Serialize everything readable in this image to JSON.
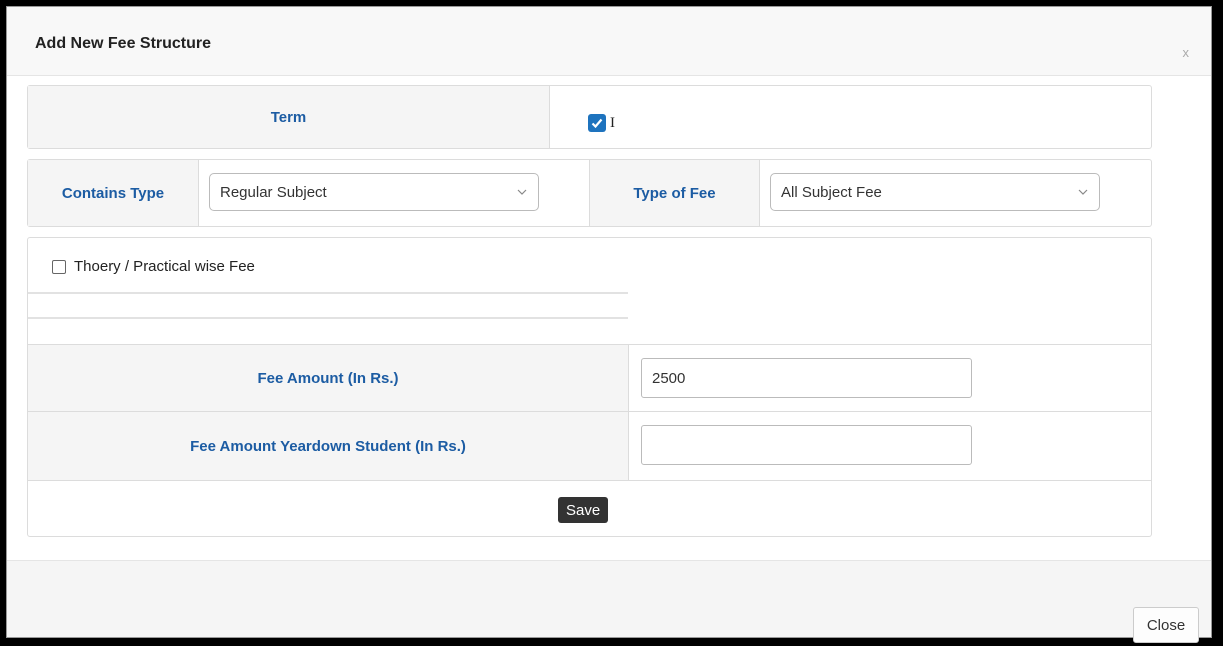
{
  "modal": {
    "title": "Add New Fee Structure",
    "close_glyph": "x"
  },
  "term": {
    "label": "Term",
    "checkbox_checked": true,
    "checkbox_label": "I",
    "check_icon": "check-icon"
  },
  "type_row": {
    "contains_type_label": "Contains Type",
    "contains_type_value": "Regular Subject",
    "type_of_fee_label": "Type of Fee",
    "type_of_fee_value": "All Subject Fee",
    "chevron_icon": "chevron-down-icon"
  },
  "thoery": {
    "checkbox_checked": false,
    "label": "Thoery / Practical wise Fee"
  },
  "fee_amount": {
    "label": "Fee Amount (In Rs.)",
    "value": "2500"
  },
  "fee_yeardown": {
    "label": "Fee Amount Yeardown Student (In Rs.)",
    "value": ""
  },
  "actions": {
    "save_label": "Save",
    "close_label": "Close"
  },
  "colors": {
    "label_blue": "#1c5ca3",
    "checkbox_blue": "#1e73be",
    "save_bg": "#333333"
  }
}
